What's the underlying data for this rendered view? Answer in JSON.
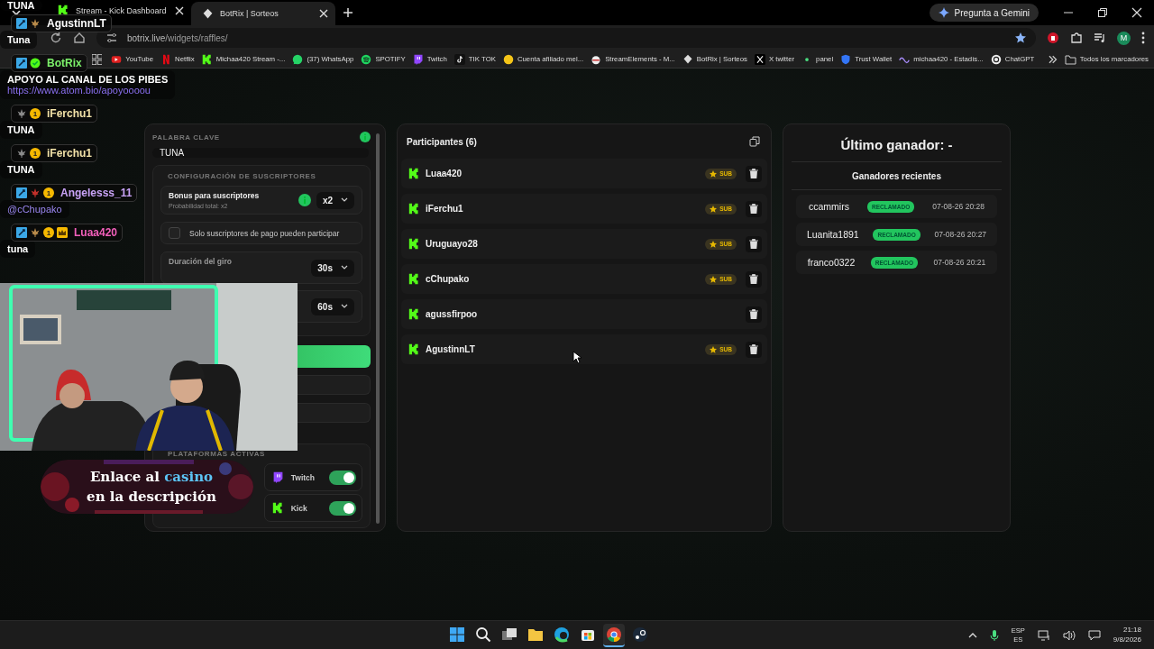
{
  "browser": {
    "tabs": [
      {
        "title": "Stream - Kick Dashboard",
        "kind": "kick",
        "selected": false
      },
      {
        "title": "BotRix | Sorteos",
        "kind": "botrix",
        "selected": true
      }
    ],
    "gemini_button": "Pregunta a Gemini",
    "address": {
      "host": "botrix.live",
      "path": "/widgets/raffles/"
    },
    "bookmarked": true,
    "profile": "M",
    "bookmarks": [
      {
        "label": "YouTube",
        "kind": "youtube"
      },
      {
        "label": "Netflix",
        "kind": "netflix"
      },
      {
        "label": "Michaa420 Stream -...",
        "kind": "kick"
      },
      {
        "label": "(37) WhatsApp",
        "kind": "whatsapp"
      },
      {
        "label": "SPOTIFY",
        "kind": "spotify"
      },
      {
        "label": "Twitch",
        "kind": "twitch"
      },
      {
        "label": "TIK TOK",
        "kind": "tiktok"
      },
      {
        "label": "Cuenta afiliado mel...",
        "kind": "coin"
      },
      {
        "label": "StreamElements - M...",
        "kind": "streamelements"
      },
      {
        "label": "BotRix | Sorteos",
        "kind": "botrix"
      },
      {
        "label": "X twitter",
        "kind": "x"
      },
      {
        "label": "panel",
        "kind": "dot"
      },
      {
        "label": "Trust Wallet",
        "kind": "shield"
      },
      {
        "label": "michaa420 - Estadís...",
        "kind": "wave"
      },
      {
        "label": "ChatGPT",
        "kind": "chatgpt"
      }
    ],
    "all_bookmarks": "Todos los marcadores"
  },
  "chat": [
    {
      "lines": [
        {
          "text": "TUNA",
          "kind": "text"
        }
      ]
    },
    {
      "user": "AgustinnLT",
      "color": "#ffffff",
      "badges": [
        {
          "kind": "mod"
        },
        {
          "kind": "leaf",
          "color": "#b88a4a"
        }
      ],
      "lines": [
        {
          "text": "Tuna",
          "kind": "text"
        }
      ]
    },
    {
      "user": "BotRix",
      "color": "#7cf06a",
      "badges": [
        {
          "kind": "mod"
        },
        {
          "kind": "verified"
        }
      ],
      "lines": [
        {
          "text": "APOYO AL CANAL DE LOS PIBES",
          "kind": "text"
        },
        {
          "text": "https://www.atom.bio/apoyoooou",
          "kind": "link"
        }
      ]
    },
    {
      "user": "iFerchu1",
      "color": "#f3e2a8",
      "badges": [
        {
          "kind": "leaf",
          "color": "#8a8a8a"
        },
        {
          "kind": "tier",
          "label": "1"
        }
      ],
      "lines": [
        {
          "text": "TUNA",
          "kind": "text"
        }
      ]
    },
    {
      "user": "iFerchu1",
      "color": "#f3e2a8",
      "badges": [
        {
          "kind": "leaf",
          "color": "#8a8a8a"
        },
        {
          "kind": "tier",
          "label": "1"
        }
      ],
      "lines": [
        {
          "text": "TUNA",
          "kind": "text"
        }
      ]
    },
    {
      "user": "Angelesss_11",
      "color": "#c9a3f7",
      "badges": [
        {
          "kind": "mod"
        },
        {
          "kind": "leaf",
          "color": "#c0302a"
        },
        {
          "kind": "tier",
          "label": "1"
        }
      ],
      "lines": [
        {
          "text": "@cChupako",
          "kind": "mention"
        }
      ]
    },
    {
      "user": "Luaa420",
      "color": "#f25fba",
      "badges": [
        {
          "kind": "mod"
        },
        {
          "kind": "leaf",
          "color": "#b88a4a"
        },
        {
          "kind": "tier",
          "label": "1"
        },
        {
          "kind": "crown"
        }
      ],
      "lines": [
        {
          "text": "tuna",
          "kind": "text"
        }
      ]
    }
  ],
  "banner": {
    "lines": [
      [
        {
          "text": "Enlace al ",
          "accent": false
        },
        {
          "text": "casino",
          "accent": true
        }
      ],
      [
        {
          "text": "en la descripción",
          "accent": false
        }
      ]
    ]
  },
  "settings": {
    "keyword_label": "PALABRA CLAVE",
    "keyword": "TUNA",
    "subs_title": "CONFIGURACIÓN DE SUSCRIPTORES",
    "bonus": {
      "label": "Bonus para suscriptores",
      "hint": "Probabilidad total: x2",
      "value": "x2"
    },
    "paid_only": {
      "label": "Solo suscriptores de pago pueden participar",
      "checked": false
    },
    "durations": [
      {
        "label": "Duración del giro",
        "value": "30s"
      },
      {
        "value": "60s"
      }
    ],
    "platforms_title": "PLATAFORMAS ACTIVAS",
    "platforms": [
      {
        "name": "Twitch",
        "kind": "twitch",
        "on": true
      },
      {
        "name": "Kick",
        "kind": "kick",
        "on": true
      }
    ]
  },
  "participants": {
    "title": "Participantes (6)",
    "rows": [
      {
        "name": "Luaa420",
        "kind": "kick",
        "sub": true,
        "badge": "SUB"
      },
      {
        "name": "iFerchu1",
        "kind": "kick",
        "sub": true,
        "badge": "SUB"
      },
      {
        "name": "Uruguayo28",
        "kind": "kick",
        "sub": true,
        "badge": "SUB"
      },
      {
        "name": "cChupako",
        "kind": "kick",
        "sub": true,
        "badge": "SUB"
      },
      {
        "name": "agussfirpoo",
        "kind": "kick",
        "sub": false
      },
      {
        "name": "AgustinnLT",
        "kind": "kick",
        "sub": true,
        "badge": "SUB"
      }
    ]
  },
  "winner": {
    "title": "Último ganador: -",
    "recent_title": "Ganadores recientes",
    "rows": [
      {
        "name": "ccammirs",
        "status": "RECLAMADO",
        "time": "07-08-26 20:28"
      },
      {
        "name": "Luanita1891",
        "status": "RECLAMADO",
        "time": "07-08-26 20:27"
      },
      {
        "name": "franco0322",
        "status": "RECLAMADO",
        "time": "07-08-26 20:21"
      }
    ]
  },
  "taskbar": {
    "apps": [
      {
        "kind": "windows",
        "active": false
      },
      {
        "kind": "search",
        "active": false
      },
      {
        "kind": "taskview",
        "active": false
      },
      {
        "kind": "files",
        "active": false
      },
      {
        "kind": "edge",
        "active": false
      },
      {
        "kind": "store",
        "active": false
      },
      {
        "kind": "chrome",
        "active": true
      },
      {
        "kind": "steam",
        "active": false
      }
    ],
    "lang": "ESP",
    "layout": "ES",
    "time": "21:18",
    "date": "9/8/2026"
  }
}
